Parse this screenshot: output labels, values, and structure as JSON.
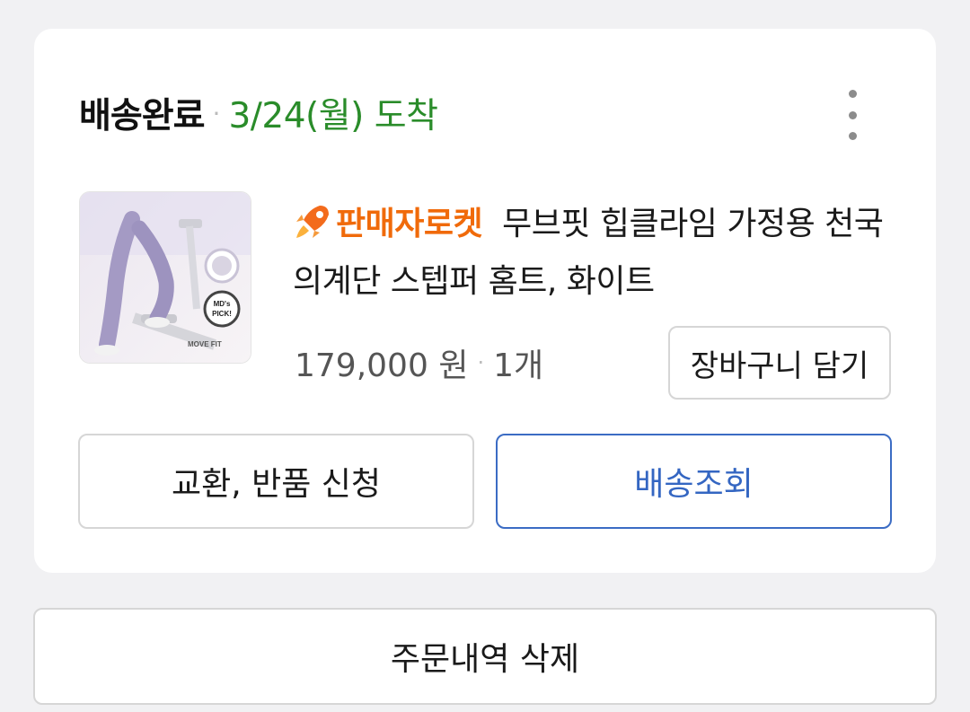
{
  "order": {
    "status": "배송완료",
    "separator": "·",
    "arrival": "3/24(월) 도착",
    "more_icon": "more-vertical-icon"
  },
  "product": {
    "badge": "판매자로켓",
    "badge_icon": "rocket-icon",
    "title": "무브핏 힙클라임 가정용 천국의계단 스텝퍼 홈트, 화이트",
    "price": "179,000 원",
    "quantity": "1개",
    "thumbnail_labels": {
      "brand": "MOVE FIT",
      "pick": "MD's PICK!"
    }
  },
  "buttons": {
    "add_to_cart": "장바구니 담기",
    "exchange_return": "교환, 반품 신청",
    "track_delivery": "배송조회",
    "delete_order": "주문내역 삭제"
  },
  "colors": {
    "arrival_green": "#2a8c2a",
    "badge_orange": "#f06a0a",
    "track_blue": "#3466c2",
    "page_bg": "#f1f1f3"
  }
}
